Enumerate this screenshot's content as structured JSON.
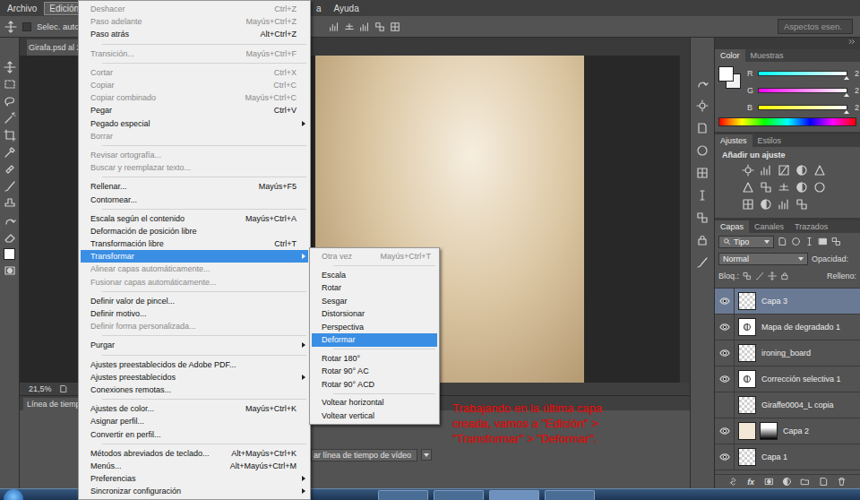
{
  "menubar": [
    {
      "label": "Archivo",
      "selected": false
    },
    {
      "label": "Edición",
      "selected": true
    },
    {
      "label": "a",
      "selected": false
    },
    {
      "label": "Ayuda",
      "selected": false
    }
  ],
  "options_bar": {
    "auto_select": {
      "label": "Selec. autom.",
      "checked": false
    },
    "workspace": "Aspectos esen."
  },
  "document_tab": {
    "title": "Girafa.psd al 2",
    "selected": true
  },
  "status_bar": {
    "zoom": "21,5%"
  },
  "timeline": {
    "title": "Línea de tiemp",
    "button": "ar línea de tiempo de vídeo"
  },
  "annotation": {
    "lines": [
      "Trabajando en la última capa",
      "creada, vamos a \"Edición\" >",
      "\"Transformar\" > \"Deformar\"."
    ]
  },
  "edit_menu": [
    {
      "kind": "item",
      "label": "Deshacer",
      "shortcut": "Ctrl+Z",
      "disabled": true,
      "submenu": false,
      "selected": false
    },
    {
      "kind": "item",
      "label": "Paso adelante",
      "shortcut": "Mayús+Ctrl+Z",
      "disabled": true,
      "submenu": false,
      "selected": false
    },
    {
      "kind": "item",
      "label": "Paso atrás",
      "shortcut": "Alt+Ctrl+Z",
      "disabled": false,
      "submenu": false,
      "selected": false
    },
    {
      "kind": "separator"
    },
    {
      "kind": "item",
      "label": "Transición...",
      "shortcut": "Mayús+Ctrl+F",
      "disabled": true,
      "submenu": false,
      "selected": false
    },
    {
      "kind": "separator"
    },
    {
      "kind": "item",
      "label": "Cortar",
      "shortcut": "Ctrl+X",
      "disabled": true,
      "submenu": false,
      "selected": false
    },
    {
      "kind": "item",
      "label": "Copiar",
      "shortcut": "Ctrl+C",
      "disabled": true,
      "submenu": false,
      "selected": false
    },
    {
      "kind": "item",
      "label": "Copiar combinado",
      "shortcut": "Mayús+Ctrl+C",
      "disabled": true,
      "submenu": false,
      "selected": false
    },
    {
      "kind": "item",
      "label": "Pegar",
      "shortcut": "Ctrl+V",
      "disabled": false,
      "submenu": false,
      "selected": false
    },
    {
      "kind": "item",
      "label": "Pegado especial",
      "disabled": false,
      "submenu": true,
      "selected": false
    },
    {
      "kind": "item",
      "label": "Borrar",
      "disabled": true,
      "submenu": false,
      "selected": false
    },
    {
      "kind": "separator"
    },
    {
      "kind": "item",
      "label": "Revisar ortografía...",
      "disabled": true,
      "submenu": false,
      "selected": false
    },
    {
      "kind": "item",
      "label": "Buscar y reemplazar texto...",
      "disabled": true,
      "submenu": false,
      "selected": false
    },
    {
      "kind": "separator"
    },
    {
      "kind": "item",
      "label": "Rellenar...",
      "shortcut": "Mayús+F5",
      "disabled": false,
      "submenu": false,
      "selected": false
    },
    {
      "kind": "item",
      "label": "Contornear...",
      "disabled": false,
      "submenu": false,
      "selected": false
    },
    {
      "kind": "separator"
    },
    {
      "kind": "item",
      "label": "Escala según el contenido",
      "shortcut": "Mayús+Ctrl+A",
      "disabled": false,
      "submenu": false,
      "selected": false
    },
    {
      "kind": "item",
      "label": "Deformación de posición libre",
      "disabled": false,
      "submenu": false,
      "selected": false
    },
    {
      "kind": "item",
      "label": "Transformación libre",
      "shortcut": "Ctrl+T",
      "disabled": false,
      "submenu": false,
      "selected": false
    },
    {
      "kind": "item",
      "label": "Transformar",
      "disabled": false,
      "submenu": true,
      "selected": true
    },
    {
      "kind": "item",
      "label": "Alinear capas automáticamente...",
      "disabled": true,
      "submenu": false,
      "selected": false
    },
    {
      "kind": "item",
      "label": "Fusionar capas automáticamente...",
      "disabled": true,
      "submenu": false,
      "selected": false
    },
    {
      "kind": "separator"
    },
    {
      "kind": "item",
      "label": "Definir valor de pincel...",
      "disabled": false,
      "submenu": false,
      "selected": false
    },
    {
      "kind": "item",
      "label": "Definir motivo...",
      "disabled": false,
      "submenu": false,
      "selected": false
    },
    {
      "kind": "item",
      "label": "Definir forma personalizada...",
      "disabled": true,
      "submenu": false,
      "selected": false
    },
    {
      "kind": "separator"
    },
    {
      "kind": "item",
      "label": "Purgar",
      "disabled": false,
      "submenu": true,
      "selected": false
    },
    {
      "kind": "separator"
    },
    {
      "kind": "item",
      "label": "Ajustes preestablecidos de Adobe PDF...",
      "disabled": false,
      "submenu": false,
      "selected": false
    },
    {
      "kind": "item",
      "label": "Ajustes preestablecidos",
      "disabled": false,
      "submenu": true,
      "selected": false
    },
    {
      "kind": "item",
      "label": "Conexiones remotas...",
      "disabled": false,
      "submenu": false,
      "selected": false
    },
    {
      "kind": "separator"
    },
    {
      "kind": "item",
      "label": "Ajustes de color...",
      "shortcut": "Mayús+Ctrl+K",
      "disabled": false,
      "submenu": false,
      "selected": false
    },
    {
      "kind": "item",
      "label": "Asignar perfil...",
      "disabled": false,
      "submenu": false,
      "selected": false
    },
    {
      "kind": "item",
      "label": "Convertir en perfil...",
      "disabled": false,
      "submenu": false,
      "selected": false
    },
    {
      "kind": "separator"
    },
    {
      "kind": "item",
      "label": "Métodos abreviados de teclado...",
      "shortcut": "Alt+Mayús+Ctrl+K",
      "disabled": false,
      "submenu": false,
      "selected": false
    },
    {
      "kind": "item",
      "label": "Menús...",
      "shortcut": "Alt+Mayús+Ctrl+M",
      "disabled": false,
      "submenu": false,
      "selected": false
    },
    {
      "kind": "item",
      "label": "Preferencias",
      "disabled": false,
      "submenu": true,
      "selected": false
    },
    {
      "kind": "item",
      "label": "Sincronizar configuración",
      "disabled": false,
      "submenu": true,
      "selected": false
    }
  ],
  "transform_menu": [
    {
      "kind": "item",
      "label": "Otra vez",
      "shortcut": "Mayús+Ctrl+T",
      "disabled": true,
      "submenu": false,
      "selected": false
    },
    {
      "kind": "separator"
    },
    {
      "kind": "item",
      "label": "Escala",
      "disabled": false,
      "submenu": false,
      "selected": false
    },
    {
      "kind": "item",
      "label": "Rotar",
      "disabled": false,
      "submenu": false,
      "selected": false
    },
    {
      "kind": "item",
      "label": "Sesgar",
      "disabled": false,
      "submenu": false,
      "selected": false
    },
    {
      "kind": "item",
      "label": "Distorsionar",
      "disabled": false,
      "submenu": false,
      "selected": false
    },
    {
      "kind": "item",
      "label": "Perspectiva",
      "disabled": false,
      "submenu": false,
      "selected": false
    },
    {
      "kind": "item",
      "label": "Deformar",
      "disabled": false,
      "submenu": false,
      "selected": true
    },
    {
      "kind": "separator"
    },
    {
      "kind": "item",
      "label": "Rotar 180°",
      "disabled": false,
      "submenu": false,
      "selected": false
    },
    {
      "kind": "item",
      "label": "Rotar 90° AC",
      "disabled": false,
      "submenu": false,
      "selected": false
    },
    {
      "kind": "item",
      "label": "Rotar 90° ACD",
      "disabled": false,
      "submenu": false,
      "selected": false
    },
    {
      "kind": "separator"
    },
    {
      "kind": "item",
      "label": "Voltear horizontal",
      "disabled": false,
      "submenu": false,
      "selected": false
    },
    {
      "kind": "item",
      "label": "Voltear vertical",
      "disabled": false,
      "submenu": false,
      "selected": false
    }
  ],
  "color_panel": {
    "tabs": [
      {
        "label": "Color",
        "selected": true
      },
      {
        "label": "Muestras",
        "selected": false
      }
    ],
    "foreground": "#ffffff",
    "background": "#f2f2f2",
    "channels": [
      {
        "name": "R",
        "level": 1,
        "reading": "2",
        "color": "#ff0000"
      },
      {
        "name": "G",
        "level": 1,
        "reading": "2",
        "color": "#00ff00"
      },
      {
        "name": "B",
        "level": 1,
        "reading": "2",
        "color": "#0000ff"
      }
    ]
  },
  "adjustments_panel": {
    "tabs": [
      {
        "label": "Ajustes",
        "selected": true
      },
      {
        "label": "Estilos",
        "selected": false
      }
    ],
    "hint": "Añadir un ajuste"
  },
  "layers_panel": {
    "tabs": [
      {
        "label": "Capas",
        "selected": true
      },
      {
        "label": "Canales",
        "selected": false
      },
      {
        "label": "Trazados",
        "selected": false
      }
    ],
    "filter": "Tipo",
    "blend_mode": "Normal",
    "opacity_label": "Opacidad:",
    "lock_label": "Bloq.:",
    "fill_label": "Relleno:",
    "footer_fx": "fx",
    "layers": [
      {
        "name": "Capa 3",
        "kind": "pixel",
        "visible": true,
        "selected": true,
        "mask": false
      },
      {
        "name": "Mapa de degradado 1",
        "kind": "adjustment",
        "visible": true,
        "selected": false,
        "mask": false
      },
      {
        "name": "ironing_board",
        "kind": "pixel",
        "visible": true,
        "selected": false,
        "mask": false
      },
      {
        "name": "Corrección selectiva 1",
        "kind": "adjustment",
        "visible": true,
        "selected": false,
        "mask": false
      },
      {
        "name": "Giraffe0004_L copia",
        "kind": "pixel",
        "visible": false,
        "selected": false,
        "mask": false
      },
      {
        "name": "Capa 2",
        "kind": "fill",
        "visible": true,
        "selected": false,
        "mask": true
      },
      {
        "name": "Capa 1",
        "kind": "pixel",
        "visible": true,
        "selected": false,
        "mask": false
      }
    ]
  }
}
